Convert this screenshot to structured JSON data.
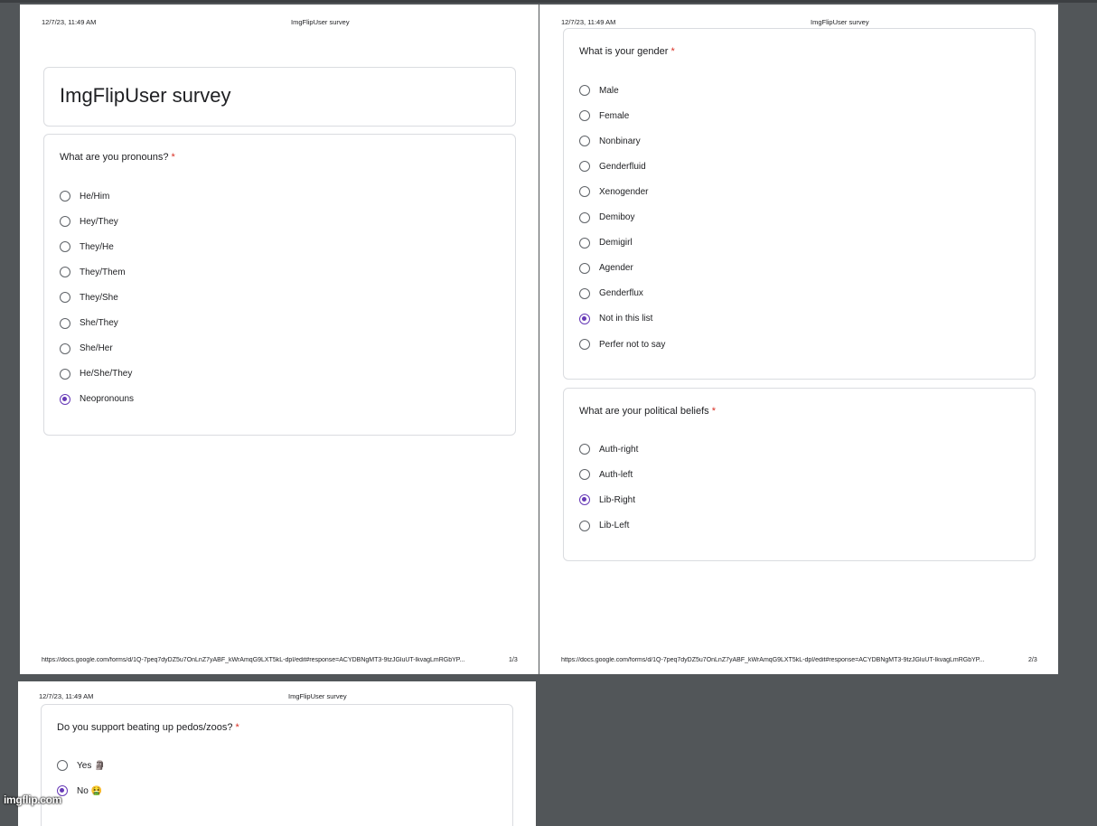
{
  "form_title": "ImgFlipUser survey",
  "print_header": {
    "datetime": "12/7/23, 11:49 AM",
    "title": "ImgFlipUser survey"
  },
  "print_footer": {
    "url": "https://docs.google.com/forms/d/1Q-7peq7dyDZ5u7OnLnZ7yABF_kWrAmqG9LXT5kL-dpI/edit#response=ACYDBNgMT3-9tzJGluUT-lkvagLmRGbYP...",
    "page1": "1/3",
    "page2": "2/3"
  },
  "questions": {
    "pronouns": {
      "text": "What are you pronouns?",
      "required": "*",
      "options": [
        "He/Him",
        "Hey/They",
        "They/He",
        "They/Them",
        "They/She",
        "She/They",
        "She/Her",
        "He/She/They",
        "Neopronouns"
      ],
      "selected": "Neopronouns"
    },
    "gender": {
      "text": "What is your gender",
      "required": "*",
      "options": [
        "Male",
        "Female",
        "Nonbinary",
        "Genderfluid",
        "Xenogender",
        "Demiboy",
        "Demigirl",
        "Agender",
        "Genderflux",
        "Not in this list",
        "Perfer not to say"
      ],
      "selected": "Not in this list"
    },
    "political": {
      "text": "What are your political beliefs",
      "required": "*",
      "options": [
        "Auth-right",
        "Auth-left",
        "Lib-Right",
        "Lib-Left"
      ],
      "selected": "Lib-Right"
    },
    "pedos": {
      "text": "Do you support beating up pedos/zoos?",
      "required": "*",
      "options": [
        "Yes 🗿",
        "No 🤮"
      ],
      "selected": "No 🤮"
    }
  },
  "watermark": "imgflip.com",
  "colors": {
    "accent": "#673ab7",
    "required": "#d93025",
    "viewer_background": "#525659"
  }
}
